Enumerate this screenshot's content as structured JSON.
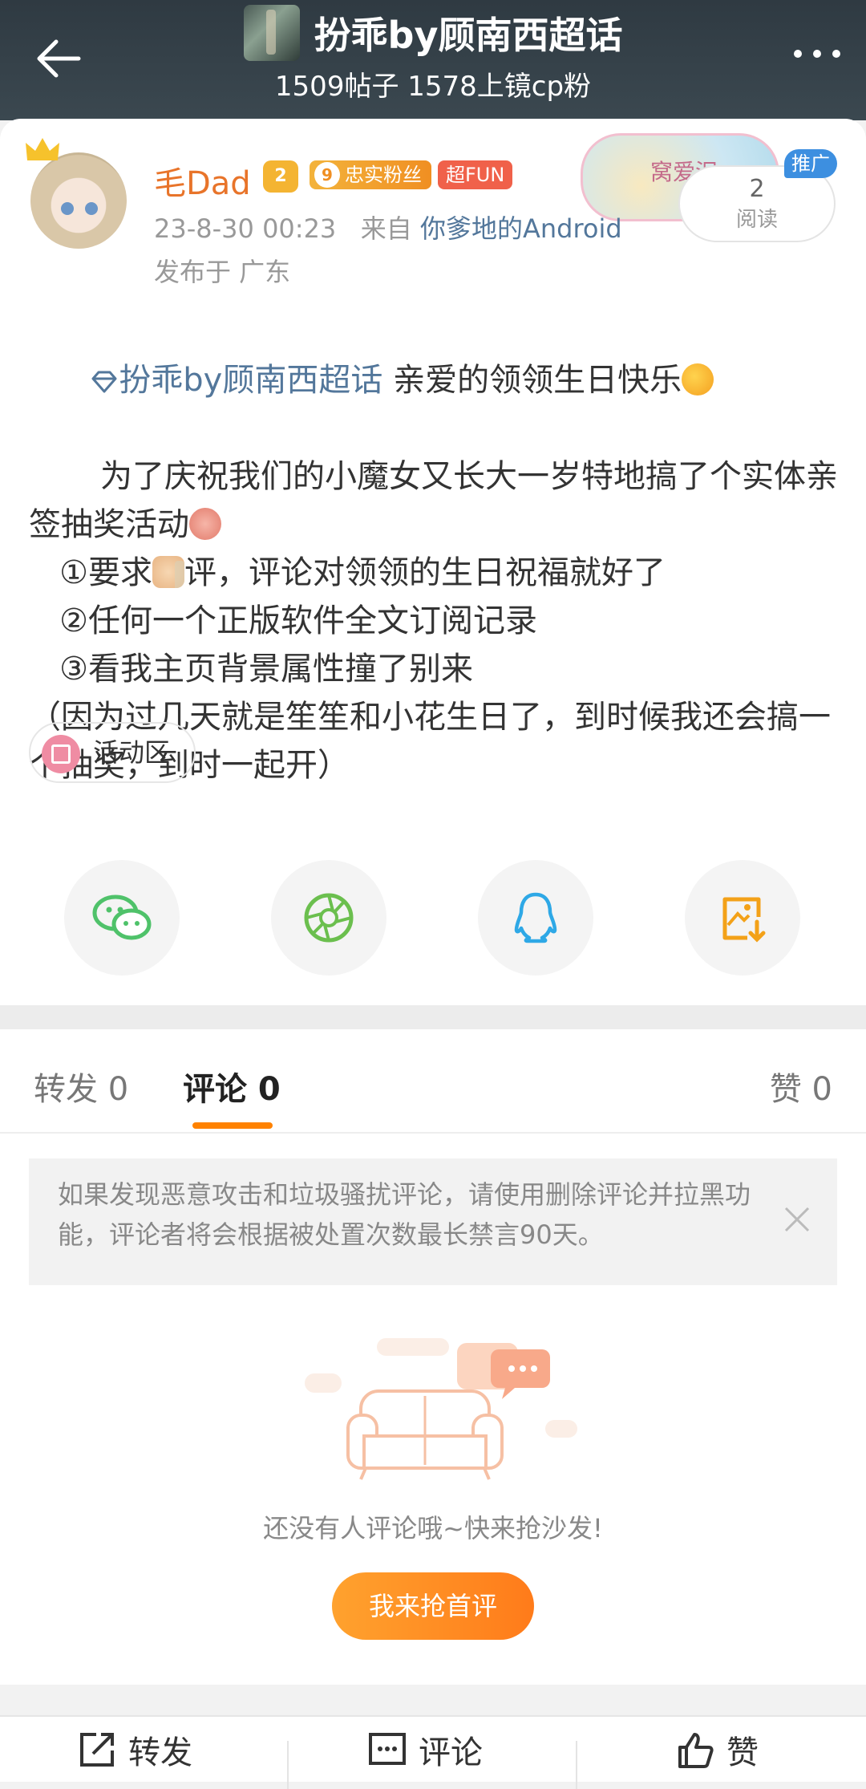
{
  "header": {
    "title": "扮乖by顾南西超话",
    "subtitle": "1509帖子 1578上镜cp粉"
  },
  "author": {
    "name": "毛Dad",
    "level": "2",
    "fan_badge_num": "9",
    "fan_badge": "忠实粉丝",
    "fun_badge": "超FUN",
    "time": "23-8-30 00:23",
    "from_prefix": "来自",
    "source": "你爹地的Android",
    "location": "发布于 广东"
  },
  "ad": {
    "image_text": "窝爱泥",
    "tag": "推广",
    "read_count": "2",
    "read_label": "阅读"
  },
  "post": {
    "topic": "扮乖by顾南西超话",
    "line1": " 亲爱的领领生日快乐",
    "line2": "       为了庆祝我们的小魔女又长大一岁特地搞了个实体亲签抽奖活动",
    "line3a": "   ①要求",
    "line3b": "评，评论对领领的生日祝福就好了",
    "line4": "   ②任何一个正版软件全文订阅记录",
    "line5": "   ③看我主页背景属性撞了别来",
    "line6": "（因为过几天就是笙笙和小花生日了，到时候我还会搞一个抽奖，到时一起开）"
  },
  "chip": {
    "label": "活动区"
  },
  "share": [
    {
      "icon": "wechat-icon",
      "color": "#4fc26a"
    },
    {
      "icon": "moments-icon",
      "color": "#6bbf4e"
    },
    {
      "icon": "qq-icon",
      "color": "#2ea8e6"
    },
    {
      "icon": "save-image-icon",
      "color": "#f3a118"
    }
  ],
  "tabs": {
    "repost": "转发 0",
    "comment": "评论 0",
    "like": "赞 0"
  },
  "notice": {
    "text": "如果发现恶意攻击和垃圾骚扰评论，请使用删除评论并拉黑功能，评论者将会根据被处置次数最长禁言90天。"
  },
  "empty": {
    "text": "还没有人评论哦~快来抢沙发!",
    "button": "我来抢首评"
  },
  "bottom": {
    "repost": "转发",
    "comment": "评论",
    "like": "赞"
  },
  "colors": {
    "accent": "#ff8200",
    "link": "#53779b",
    "username": "#e8742a"
  }
}
